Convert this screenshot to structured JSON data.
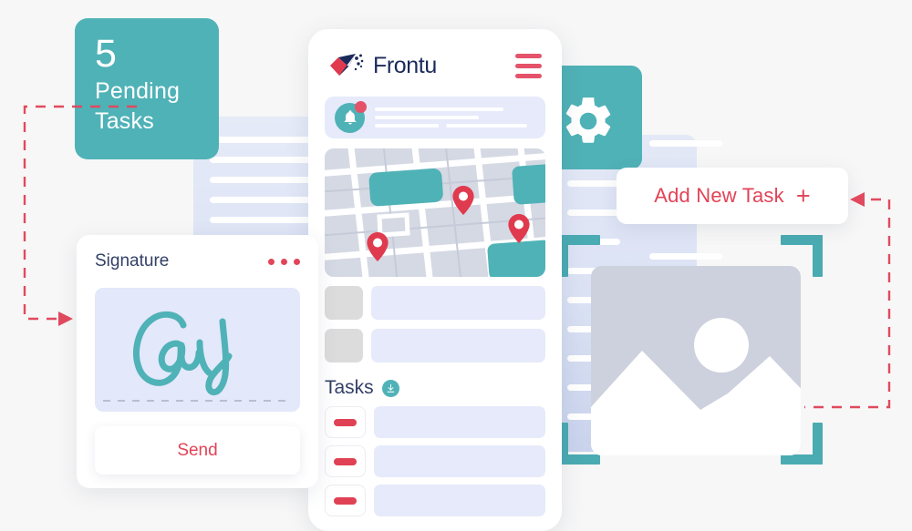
{
  "page": {
    "background_color": "#f7f7f7",
    "accent_teal": "#4fb2b7",
    "accent_red": "#e24356",
    "navy": "#1b2a5b",
    "panel_blue": "#e6eafa"
  },
  "pending_card": {
    "count": "5",
    "label_line1": "Pending",
    "label_line2": "Tasks",
    "background_color": "#4fb2b7"
  },
  "phone": {
    "brand_name": "Frontu",
    "logo_icon": "frontu-swoosh-logo",
    "menu_icon": "hamburger-menu-icon",
    "notification": {
      "icon": "bell-icon",
      "badge_icon": "badge-dot",
      "placeholder_lines": 3
    },
    "map": {
      "pin_icon": "map-pin-icon",
      "pin_count": 3
    },
    "list_rows": [
      {
        "thumb": "thumbnail-placeholder",
        "bar": "content-placeholder"
      },
      {
        "thumb": "thumbnail-placeholder",
        "bar": "content-placeholder"
      }
    ],
    "tasks": {
      "title": "Tasks",
      "download_icon": "download-arrow-icon",
      "rows": [
        {
          "action_icon": "remove-dash-icon"
        },
        {
          "action_icon": "remove-dash-icon"
        },
        {
          "action_icon": "remove-dash-icon"
        }
      ]
    }
  },
  "signature_card": {
    "title": "Signature",
    "menu_icon": "more-options-dots-icon",
    "signature_text": "Cay",
    "send_label": "Send"
  },
  "add_task_button": {
    "label": "Add New Task",
    "plus_icon": "plus-icon"
  },
  "gear_card": {
    "icon": "gear-settings-icon",
    "background_color": "#4fb2b7"
  },
  "photo_frame": {
    "image_icon": "image-placeholder-icon",
    "bracket_icon": "scan-corner-bracket-icon",
    "bracket_color": "#4aabb2"
  },
  "connectors": {
    "left_arrow_icon": "dashed-arrow-right-icon",
    "right_arrow_icon": "dashed-arrow-left-icon",
    "color": "#e04a5e"
  },
  "documents": {
    "left_card": {
      "line_count": 7
    },
    "right_card": {
      "line_count": 8
    }
  }
}
